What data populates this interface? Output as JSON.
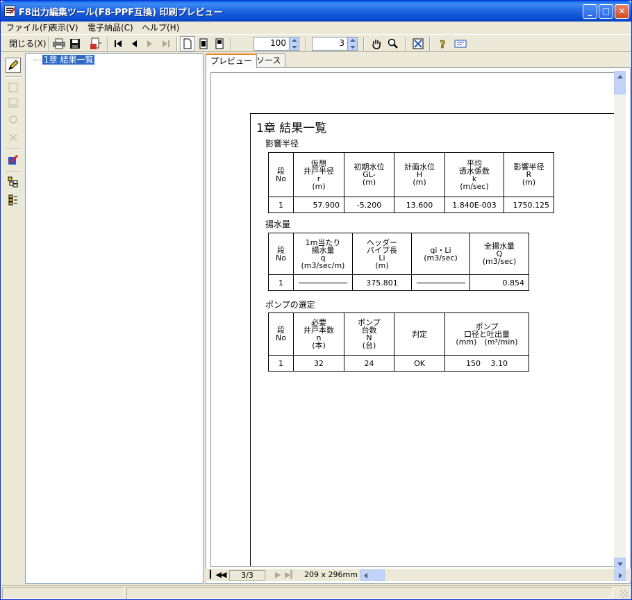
{
  "window": {
    "title": "F8出力編集ツール(F8-PPF互換) 印刷プレビュー",
    "controls": {
      "minimize": "_",
      "maximize": "□",
      "close": "✕"
    }
  },
  "menubar": {
    "items": [
      "ファイル(F)",
      "表示(V)",
      "電子納品(C)",
      "ヘルプ(H)"
    ]
  },
  "toolbar": {
    "close_label": "閉じる(X)",
    "zoom_value": "100",
    "page_value": "3"
  },
  "tree": {
    "selected_item": "1章 結果一覧"
  },
  "tabs": [
    "プレビュー",
    "ソース"
  ],
  "page": {
    "title": "1章 結果一覧",
    "sections": {
      "radius": {
        "title": "影響半径",
        "headers": [
          "段\nNo",
          "仮想\n井戸半径\nr\n(m)",
          "初期水位\nGL-\n(m)",
          "計画水位\nH\n(m)",
          "平均\n透水係数\nk\n(m/sec)",
          "影響半径\nR\n(m)"
        ],
        "row": [
          "1",
          "57.900",
          "-5.200",
          "13.600",
          "1.840E-003",
          "1750.125"
        ]
      },
      "pumping": {
        "title": "揚水量",
        "headers": [
          "段\nNo",
          "1m当たり\n揚水量\nq\n(m3/sec/m)",
          "ヘッダー\nパイプ長\nLi\n(m)",
          "qi・Li\n(m3/sec)",
          "全揚水量\nQ\n(m3/sec)"
        ],
        "row": [
          "1",
          "",
          "375.801",
          "",
          "0.854"
        ]
      },
      "pump": {
        "title": "ポンプの選定",
        "headers": [
          "段\nNo",
          "必要\n井戸本数\nn\n(本)",
          "ポンプ\n台数\nN\n(台)",
          "判定",
          "ポンプ\n口径と吐出量\n(mm)　(m³/min)"
        ],
        "row": [
          "1",
          "32",
          "24",
          "OK",
          "150　 3.10"
        ]
      }
    }
  },
  "preview_nav": {
    "page_indicator": "3/3",
    "paper_size": "209 x 296mm"
  },
  "icons": [
    "pencil-icon",
    "printer-icon",
    "save-disk-icon",
    "export-icon",
    "first-page-icon",
    "prev-page-icon",
    "next-page-icon",
    "last-page-icon",
    "single-page-icon",
    "double-page-icon",
    "multi-page-icon",
    "hand-icon",
    "magnifier-icon",
    "fit-icon",
    "help-icon",
    "info-icon"
  ]
}
